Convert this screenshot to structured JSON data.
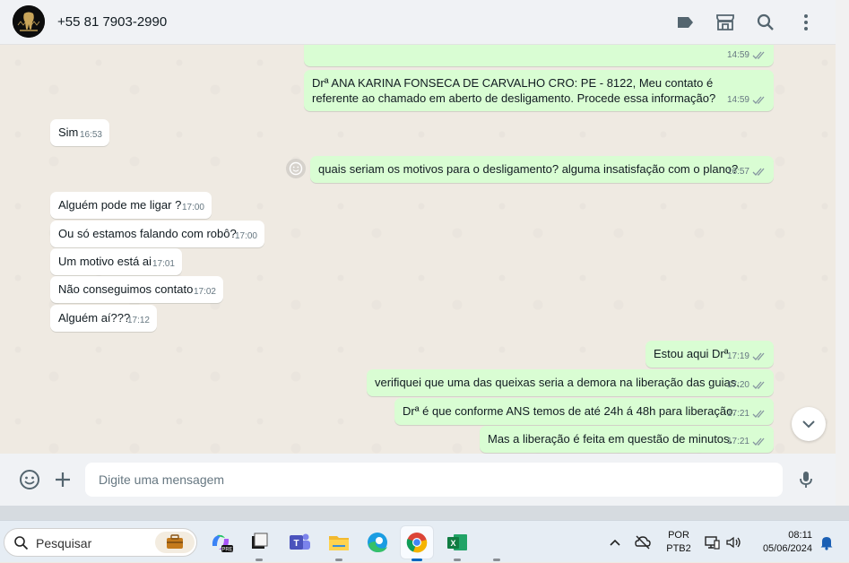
{
  "header": {
    "contact_name": "+55 81 7903-2990"
  },
  "chat": {
    "messages": [
      {
        "dir": "out",
        "text": "",
        "time": "14:59"
      },
      {
        "dir": "out",
        "text": "Drª ANA KARINA FONSECA DE CARVALHO CRO: PE - 8122, Meu contato é referente ao chamado em aberto de desligamento. Procede essa informação?",
        "time": "14:59"
      },
      {
        "dir": "in",
        "text": "Sim",
        "time": "16:53"
      },
      {
        "dir": "out",
        "text": "quais seriam os motivos para o desligamento? alguma insatisfação com o plano?",
        "time": "16:57"
      },
      {
        "dir": "in",
        "text": "Alguém pode me ligar ?",
        "time": "17:00"
      },
      {
        "dir": "in",
        "text": "Ou só estamos falando com robô?",
        "time": "17:00"
      },
      {
        "dir": "in",
        "text": "Um motivo está ai",
        "time": "17:01"
      },
      {
        "dir": "in",
        "text": "Não conseguimos contato",
        "time": "17:02"
      },
      {
        "dir": "in",
        "text": "Alguém aí???",
        "time": "17:12"
      },
      {
        "dir": "out",
        "text": "Estou aqui Drª",
        "time": "17:19"
      },
      {
        "dir": "out",
        "text": "verifiquei que uma das queixas seria a demora na liberação das guias.",
        "time": "17:20"
      },
      {
        "dir": "out",
        "text": "Drª é que conforme ANS temos de até 24h á 48h para liberação.",
        "time": "17:21"
      },
      {
        "dir": "out",
        "text": "Mas a liberação é feita em questão de minutos.",
        "time": "17:21"
      }
    ]
  },
  "footer": {
    "placeholder": "Digite uma mensagem"
  },
  "taskbar": {
    "search_label": "Pesquisar",
    "lang_top": "POR",
    "lang_bottom": "PTB2",
    "time": "08:11",
    "date": "05/06/2024"
  },
  "colors": {
    "outgoing_bubble": "#d9fdd3",
    "incoming_bubble": "#ffffff",
    "chat_bg": "#efeae2",
    "header_bg": "#f0f2f5"
  }
}
